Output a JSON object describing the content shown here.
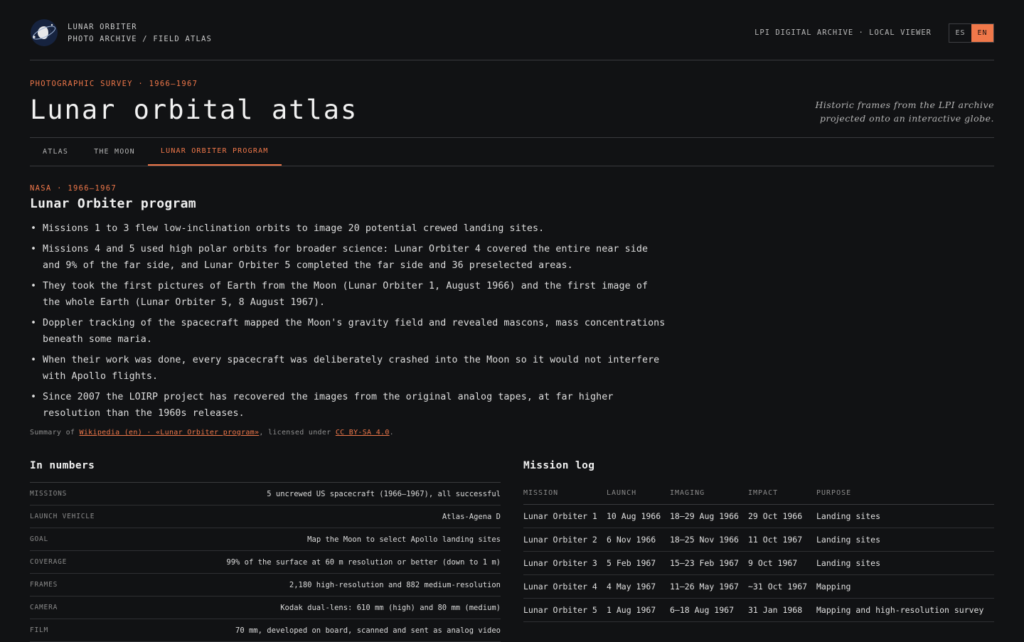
{
  "header": {
    "brand_line1": "LUNAR ORBITER",
    "brand_line2": "PHOTO ARCHIVE / FIELD ATLAS",
    "archive_link": "LPI DIGITAL ARCHIVE · LOCAL VIEWER",
    "lang_es": "ES",
    "lang_en": "EN",
    "active_lang": "EN"
  },
  "hero": {
    "kicker": "PHOTOGRAPHIC SURVEY · 1966–1967",
    "title": "Lunar orbital atlas",
    "tagline_line1": "Historic frames from the LPI archive",
    "tagline_line2": "projected onto an interactive globe."
  },
  "tabs": [
    "ATLAS",
    "THE MOON",
    "LUNAR ORBITER PROGRAM"
  ],
  "active_tab": "LUNAR ORBITER PROGRAM",
  "program": {
    "kicker": "NASA · 1966–1967",
    "title": "Lunar Orbiter program",
    "bullets": [
      "Missions 1 to 3 flew low-inclination orbits to image 20 potential crewed landing sites.",
      "Missions 4 and 5 used high polar orbits for broader science: Lunar Orbiter 4 covered the entire near side and 9% of the far side, and Lunar Orbiter 5 completed the far side and 36 preselected areas.",
      "They took the first pictures of Earth from the Moon (Lunar Orbiter 1, August 1966) and the first image of the whole Earth (Lunar Orbiter 5, 8 August 1967).",
      "Doppler tracking of the spacecraft mapped the Moon's gravity field and revealed mascons, mass concentrations beneath some maria.",
      "When their work was done, every spacecraft was deliberately crashed into the Moon so it would not interfere with Apollo flights.",
      "Since 2007 the LOIRP project has recovered the images from the original analog tapes, at far higher resolution than the 1960s releases."
    ],
    "attribution_prefix": "Summary of ",
    "attribution_source": "Wikipedia (en) · «Lunar Orbiter program»",
    "attribution_mid": ", licensed under ",
    "attribution_license": "CC BY-SA 4.0",
    "attribution_suffix": "."
  },
  "numbers": {
    "title": "In numbers",
    "rows": [
      {
        "key": "MISSIONS",
        "value": "5 uncrewed US spacecraft (1966–1967), all successful"
      },
      {
        "key": "LAUNCH VEHICLE",
        "value": "Atlas-Agena D"
      },
      {
        "key": "GOAL",
        "value": "Map the Moon to select Apollo landing sites"
      },
      {
        "key": "COVERAGE",
        "value": "99% of the surface at 60 m resolution or better (down to 1 m)"
      },
      {
        "key": "FRAMES",
        "value": "2,180 high-resolution and 882 medium-resolution"
      },
      {
        "key": "CAMERA",
        "value": "Kodak dual-lens: 610 mm (high) and 80 mm (medium)"
      },
      {
        "key": "FILM",
        "value": "70 mm, developed on board, scanned and sent as analog video"
      }
    ]
  },
  "mission_log": {
    "title": "Mission log",
    "columns": [
      "MISSION",
      "LAUNCH",
      "IMAGING",
      "IMPACT",
      "PURPOSE"
    ],
    "rows": [
      [
        "Lunar Orbiter 1",
        "10 Aug 1966",
        "18–29 Aug 1966",
        "29 Oct 1966",
        "Landing sites"
      ],
      [
        "Lunar Orbiter 2",
        "6 Nov 1966",
        "18–25 Nov 1966",
        "11 Oct 1967",
        "Landing sites"
      ],
      [
        "Lunar Orbiter 3",
        "5 Feb 1967",
        "15–23 Feb 1967",
        "9 Oct 1967",
        "Landing sites"
      ],
      [
        "Lunar Orbiter 4",
        "4 May 1967",
        "11–26 May 1967",
        "~31 Oct 1967",
        "Mapping"
      ],
      [
        "Lunar Orbiter 5",
        "1 Aug 1967",
        "6–18 Aug 1967",
        "31 Jan 1968",
        "Mapping and high-resolution survey"
      ]
    ]
  },
  "colors": {
    "background": "#111214",
    "accent": "#f0784a",
    "rule": "#3a3b3e"
  },
  "icons": {
    "logo": "moon-orbit-logo-icon"
  }
}
